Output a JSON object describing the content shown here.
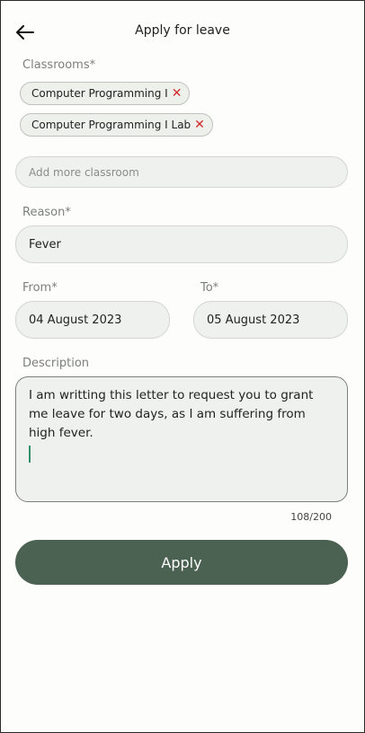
{
  "header": {
    "title": "Apply for leave",
    "back_icon": "arrow-left-icon"
  },
  "classrooms": {
    "label": "Classrooms*",
    "selected": [
      {
        "label": "Computer Programming I",
        "remove_icon": "close-icon",
        "remove_color": "#d12b2b"
      },
      {
        "label": "Computer Programming I Lab",
        "remove_icon": "close-icon",
        "remove_color": "#d12b2b"
      }
    ],
    "add_placeholder": "Add more classroom"
  },
  "reason": {
    "label": "Reason*",
    "value": "Fever"
  },
  "from": {
    "label": "From*",
    "value": "04 August 2023"
  },
  "to": {
    "label": "To*",
    "value": "05 August 2023"
  },
  "description": {
    "label": "Description",
    "value": "I am writting this letter to request you to grant me leave for two days, as I am suffering from high fever.",
    "counter": "108/200"
  },
  "apply_button": {
    "label": "Apply"
  },
  "colors": {
    "accent": "#4b6151",
    "field_bg": "#eef1ed",
    "caret": "#2f8f68"
  }
}
